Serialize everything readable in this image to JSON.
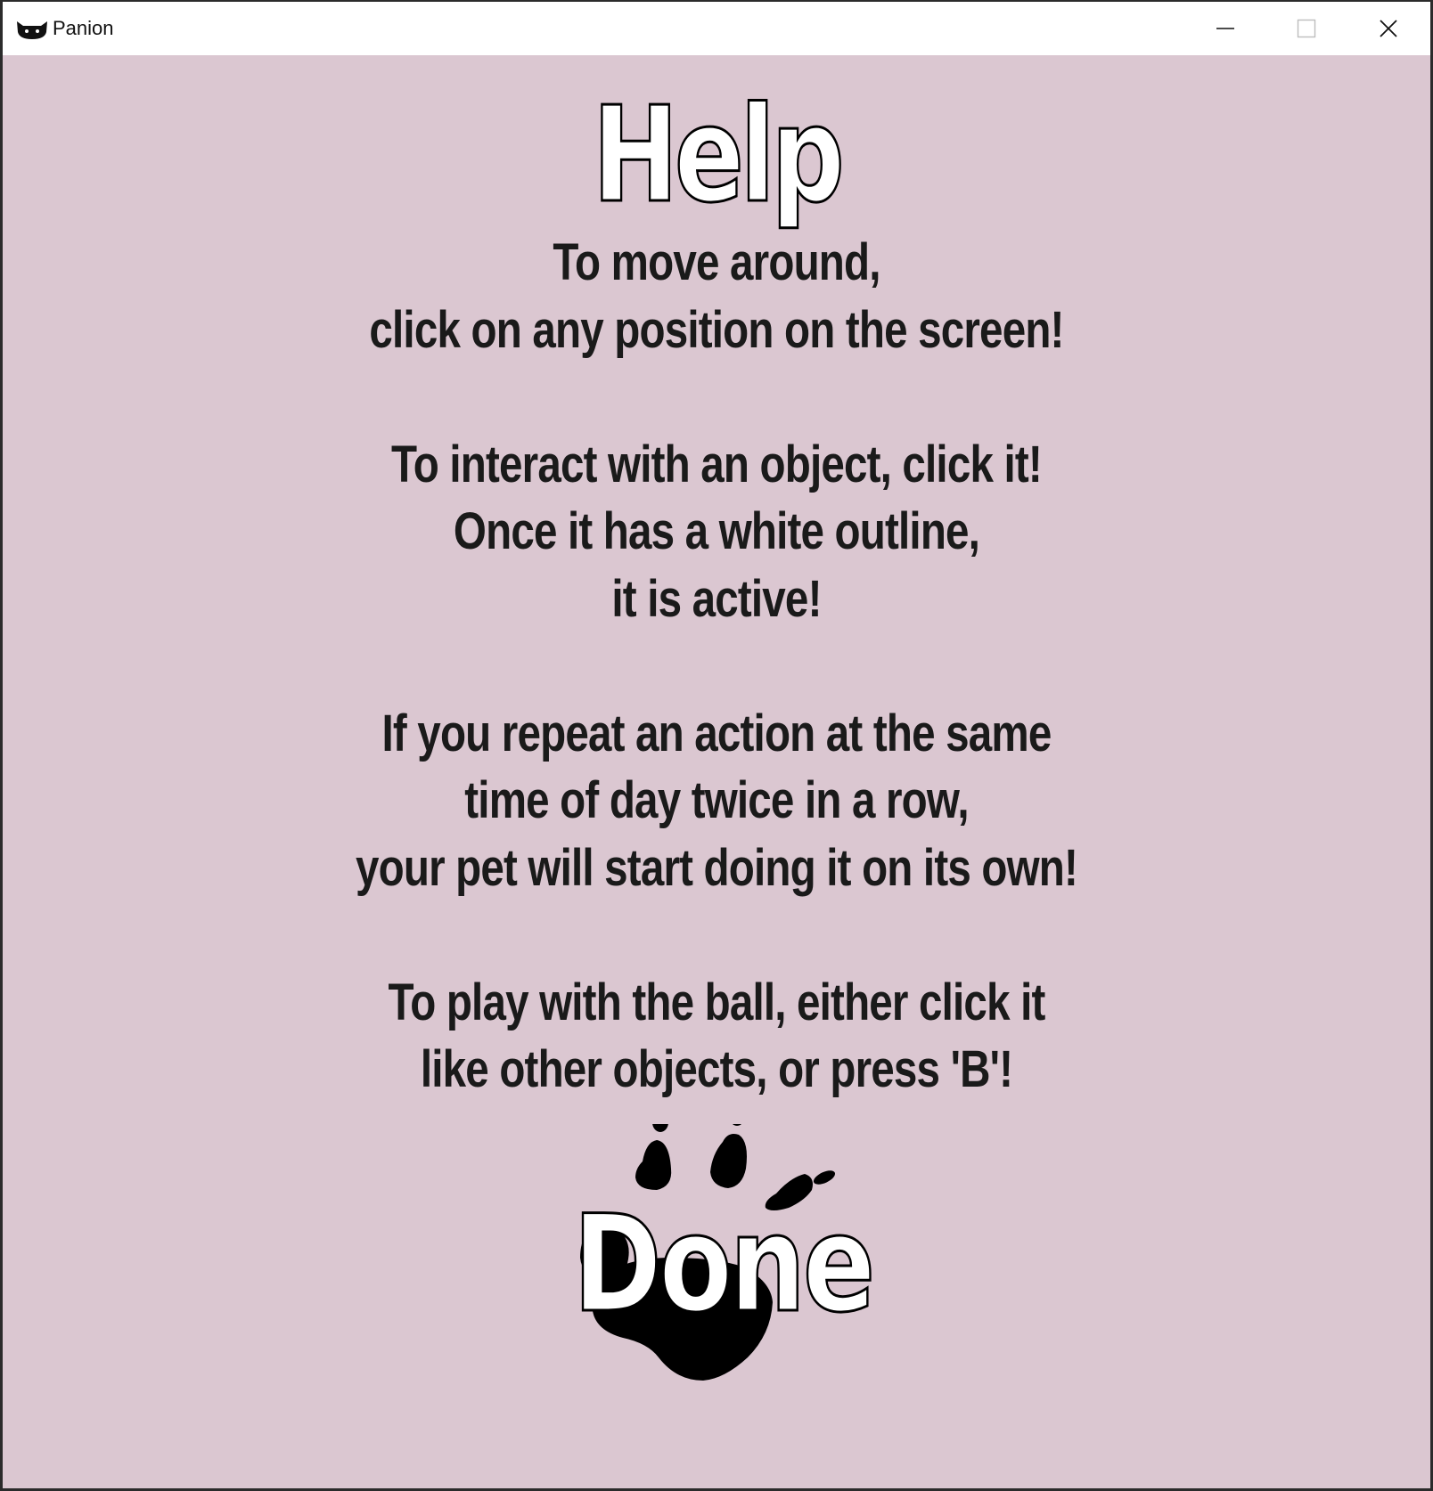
{
  "window": {
    "title": "Panion",
    "icon": "cat-face-icon",
    "controls": [
      "minimize-icon",
      "maximize-icon",
      "close-icon"
    ]
  },
  "help": {
    "title": "Help",
    "lines": [
      "To move around,",
      "click on any position on the screen!",
      "",
      "To interact with an object, click it!",
      "Once it has a white outline,",
      "it is active!",
      "",
      "If you repeat an action at the same",
      "time of day twice in a row,",
      "your pet will start doing it on its own!",
      "",
      "To play with the ball, either click it",
      "like other objects, or press 'B'!"
    ],
    "done_label": "Done",
    "done_icon": "paw-print-icon"
  },
  "colors": {
    "background": "#dbc7d1",
    "titlebar": "#ffffff",
    "text": "#1a1a1a",
    "outline_text_fill": "#ffffff"
  }
}
